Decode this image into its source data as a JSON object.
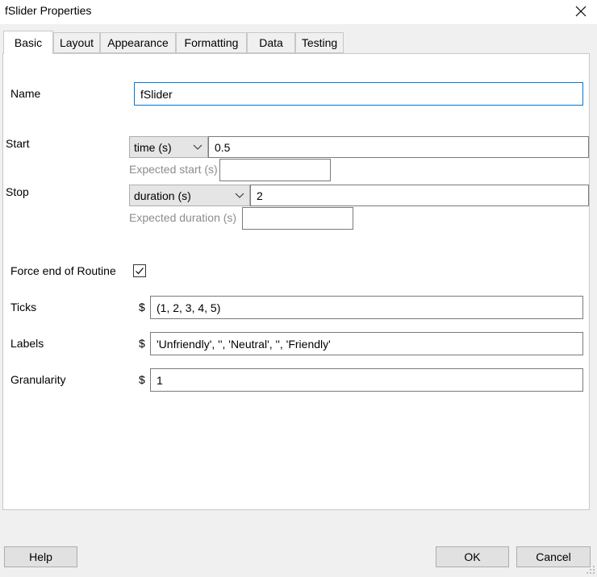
{
  "window": {
    "title": "fSlider Properties"
  },
  "tabs": [
    {
      "label": "Basic"
    },
    {
      "label": "Layout"
    },
    {
      "label": "Appearance"
    },
    {
      "label": "Formatting"
    },
    {
      "label": "Data"
    },
    {
      "label": "Testing"
    }
  ],
  "fields": {
    "name": {
      "label": "Name",
      "value": "fSlider"
    },
    "start": {
      "label": "Start",
      "type": "time (s)",
      "value": "0.5",
      "expected_label": "Expected start (s)",
      "expected_value": ""
    },
    "stop": {
      "label": "Stop",
      "type": "duration (s)",
      "value": "2",
      "expected_label": "Expected duration (s)",
      "expected_value": ""
    },
    "force_end": {
      "label": "Force end of Routine",
      "checked": true
    },
    "ticks": {
      "label": "Ticks",
      "prefix": "$",
      "value": "(1, 2, 3, 4, 5)"
    },
    "labels": {
      "label": "Labels",
      "prefix": "$",
      "value": "'Unfriendly', '', 'Neutral', '', 'Friendly'"
    },
    "granularity": {
      "label": "Granularity",
      "prefix": "$",
      "value": "1"
    }
  },
  "buttons": {
    "help": "Help",
    "ok": "OK",
    "cancel": "Cancel"
  },
  "icons": {
    "close": "close-icon",
    "dropdown": "chevron-down-icon",
    "check": "checkmark-icon",
    "grip": "resize-grip-icon"
  }
}
